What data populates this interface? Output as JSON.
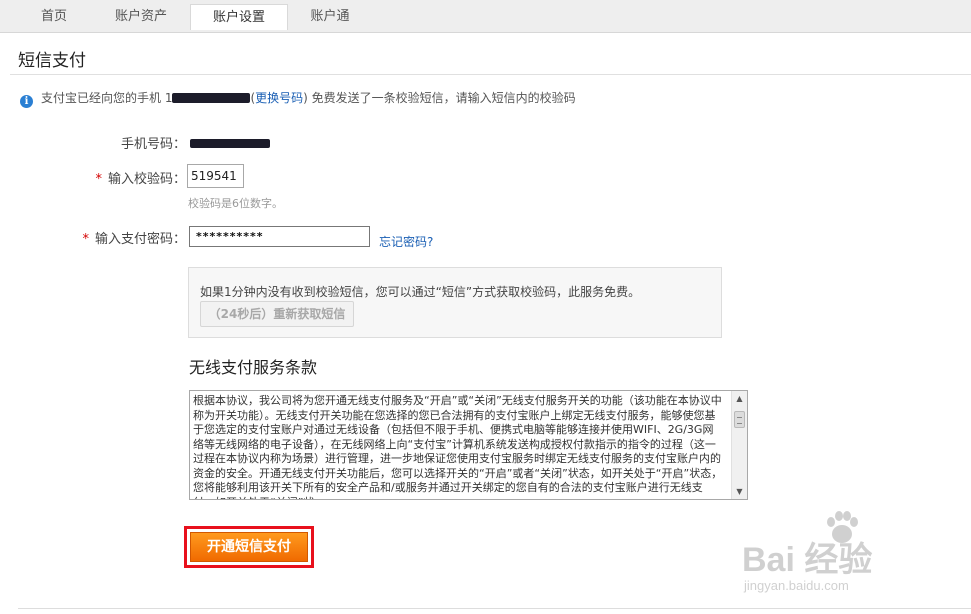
{
  "nav": {
    "tabs": [
      {
        "label": "首页"
      },
      {
        "label": "账户资产"
      },
      {
        "label": "账户设置"
      },
      {
        "label": "账户通"
      }
    ],
    "active_tab": "账户设置"
  },
  "page_title": "短信支付",
  "info": {
    "prefix": "支付宝已经向您的手机 1",
    "change_link": "更换号码",
    "suffix": "免费发送了一条校验短信，请输入短信内的校验码"
  },
  "form": {
    "phone_label": "手机号码：",
    "code_label": "输入校验码：",
    "code_value": "519541",
    "code_hint": "校验码是6位数字。",
    "password_label": "输入支付密码：",
    "password_value": "**********",
    "forgot_link": "忘记密码?"
  },
  "resend": {
    "text": "如果1分钟内没有收到校验短信，您可以通过“短信”方式获取校验码，此服务免费。",
    "button_label": "（24秒后）重新获取短信"
  },
  "terms": {
    "title": "无线支付服务条款",
    "body": "根据本协议，我公司将为您开通无线支付服务及“开启”或“关闭”无线支付服务开关的功能（该功能在本协议中称为开关功能）。无线支付开关功能在您选择的您已合法拥有的支付宝账户上绑定无线支付服务，能够使您基于您选定的支付宝账户对通过无线设备（包括但不限于手机、便携式电脑等能够连接并使用WIFI、2G/3G网络等无线网络的电子设备），在无线网络上向“支付宝”计算机系统发送构成授权付款指示的指令的过程（这一过程在本协议内称为场景）进行管理，进一步地保证您使用支付宝服务时绑定无线支付服务的支付宝账户内的资金的安全。开通无线支付开关功能后，您可以选择开关的“开启”或者“关闭”状态，如开关处于“开启”状态，您将能够利用该开关下所有的安全产品和/或服务并通过开关绑定的您自有的合法的支付宝账户进行无线支付，如开关处于“关闭”状"
  },
  "submit_label": "开通短信支付",
  "watermark": {
    "brand": "Bai 经验",
    "url": "jingyan.baidu.com"
  },
  "colors": {
    "accent_orange": "#f47a0a",
    "highlight_red": "#e8101c",
    "link_blue": "#1a5fb4"
  }
}
